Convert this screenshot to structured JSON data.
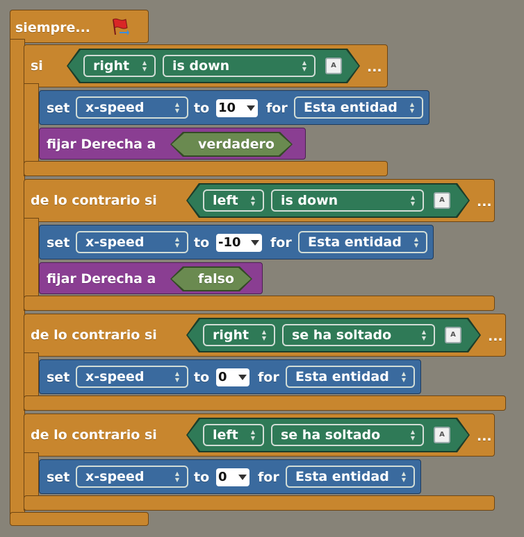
{
  "forever": {
    "label": "siempre..."
  },
  "if_block": {
    "label": "si",
    "key": "right",
    "condition": "is down",
    "ellipsis": "...",
    "set": {
      "set_label": "set",
      "variable": "x-speed",
      "to_label": "to",
      "value": "10",
      "for_label": "for",
      "target": "Esta entidad"
    },
    "assign": {
      "label": "fijar Derecha a",
      "value": "verdadero"
    }
  },
  "elseif1": {
    "label": "de lo contrario si",
    "key": "left",
    "condition": "is down",
    "ellipsis": "...",
    "set": {
      "set_label": "set",
      "variable": "x-speed",
      "to_label": "to",
      "value": "-10",
      "for_label": "for",
      "target": "Esta entidad"
    },
    "assign": {
      "label": "fijar Derecha a",
      "value": "falso"
    }
  },
  "elseif2": {
    "label": "de lo contrario si",
    "key": "right",
    "condition": "se ha soltado",
    "ellipsis": "...",
    "set": {
      "set_label": "set",
      "variable": "x-speed",
      "to_label": "to",
      "value": "0",
      "for_label": "for",
      "target": "Esta entidad"
    }
  },
  "elseif3": {
    "label": "de lo contrario si",
    "key": "left",
    "condition": "se ha soltado",
    "ellipsis": "...",
    "set": {
      "set_label": "set",
      "variable": "x-speed",
      "to_label": "to",
      "value": "0",
      "for_label": "for",
      "target": "Esta entidad"
    }
  },
  "icons": {
    "flag": "red-flag-run-icon",
    "key": "keyboard-key-icon",
    "dropdown": "updown-arrows-icon"
  },
  "colors": {
    "control": "#c8862e",
    "motion": "#3a6a9e",
    "variable": "#8a3e92",
    "sensing": "#2f7a57",
    "background": "#878378"
  }
}
